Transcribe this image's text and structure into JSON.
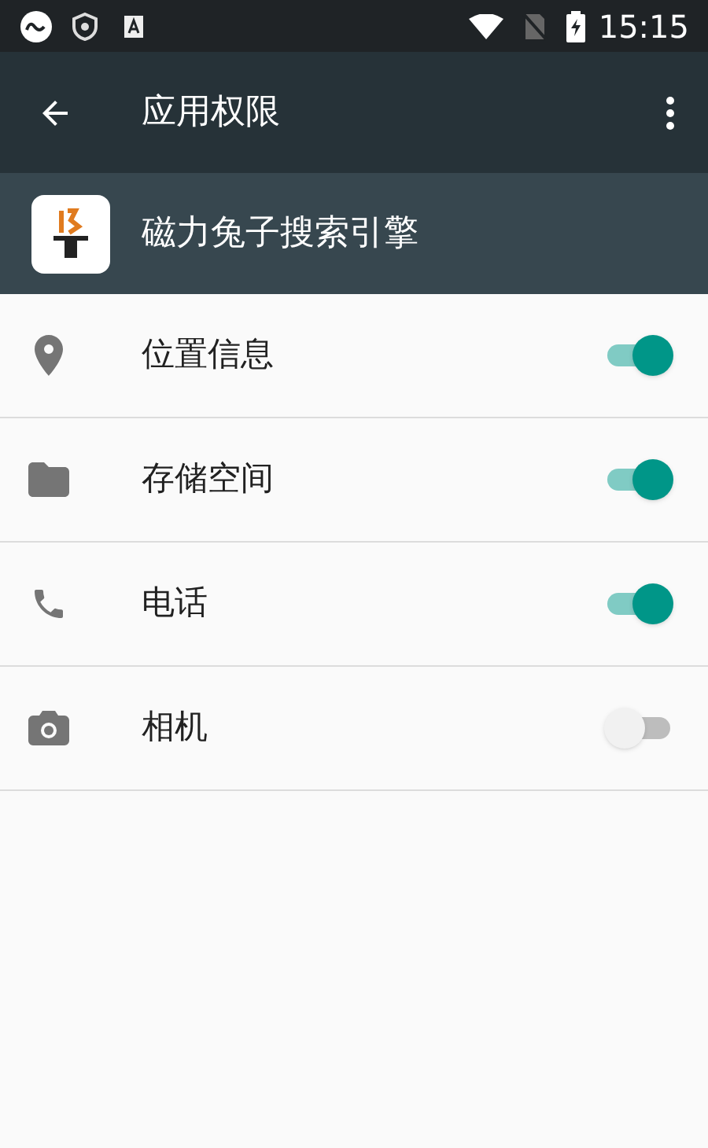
{
  "status_bar": {
    "time": "15:15"
  },
  "app_bar": {
    "title": "应用权限"
  },
  "app_header": {
    "name": "磁力兔子搜索引擎"
  },
  "permissions": [
    {
      "kind": "location",
      "label": "位置信息",
      "on": true
    },
    {
      "kind": "storage",
      "label": "存储空间",
      "on": true
    },
    {
      "kind": "phone",
      "label": "电话",
      "on": true
    },
    {
      "kind": "camera",
      "label": "相机",
      "on": false
    }
  ]
}
